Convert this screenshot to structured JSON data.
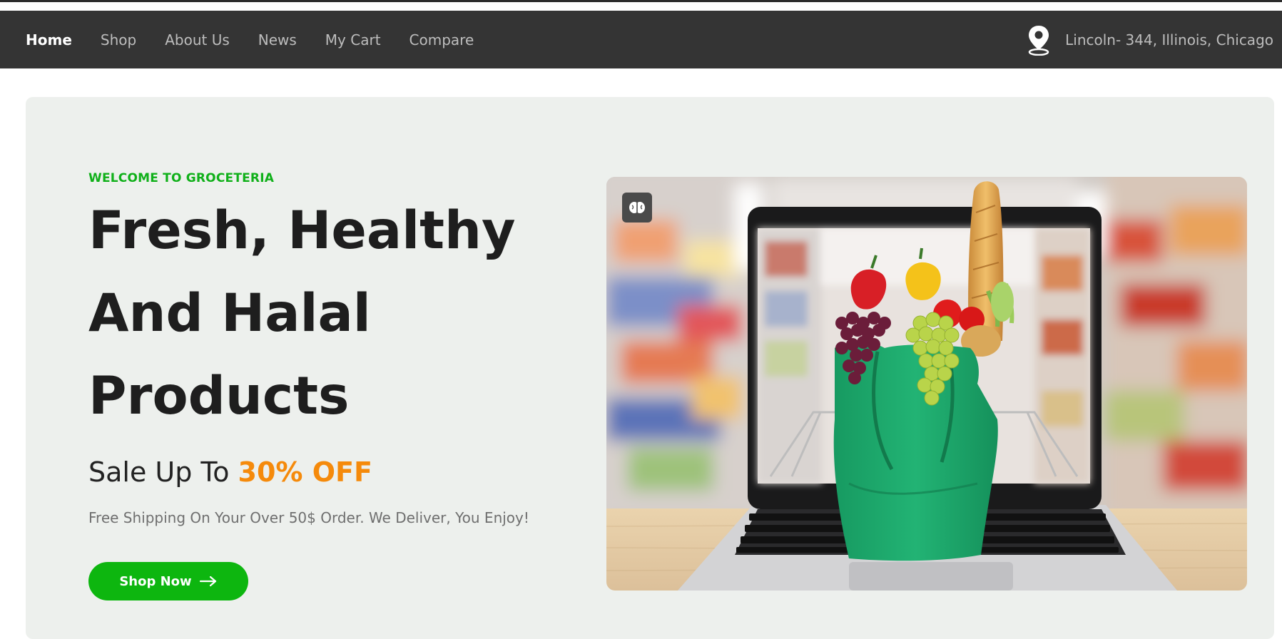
{
  "nav": {
    "items": [
      {
        "label": "Home"
      },
      {
        "label": "Shop"
      },
      {
        "label": "About Us"
      },
      {
        "label": "News"
      },
      {
        "label": "My Cart"
      },
      {
        "label": "Compare"
      }
    ],
    "location_text": "Lincoln- 344, Illinois, Chicago",
    "location_icon": "map-pin-icon"
  },
  "hero": {
    "kicker": "WELCOME TO GROCETERIA",
    "headline": "Fresh, Healthy And Halal Products",
    "sale_prefix": "Sale Up To",
    "sale_highlight": "30% OFF",
    "shipping_note": "Free Shipping On Your Over 50$ Order. We Deliver, You Enjoy!",
    "cta_label": "Shop Now",
    "cta_icon": "arrow-right-icon",
    "image_badge_icon": "brain-icon"
  },
  "colors": {
    "nav_background": "#343434",
    "hero_background": "#edf0ed",
    "brand_green": "#0db60f",
    "accent_orange": "#f58a0b",
    "bag_green": "#1fa86c"
  }
}
